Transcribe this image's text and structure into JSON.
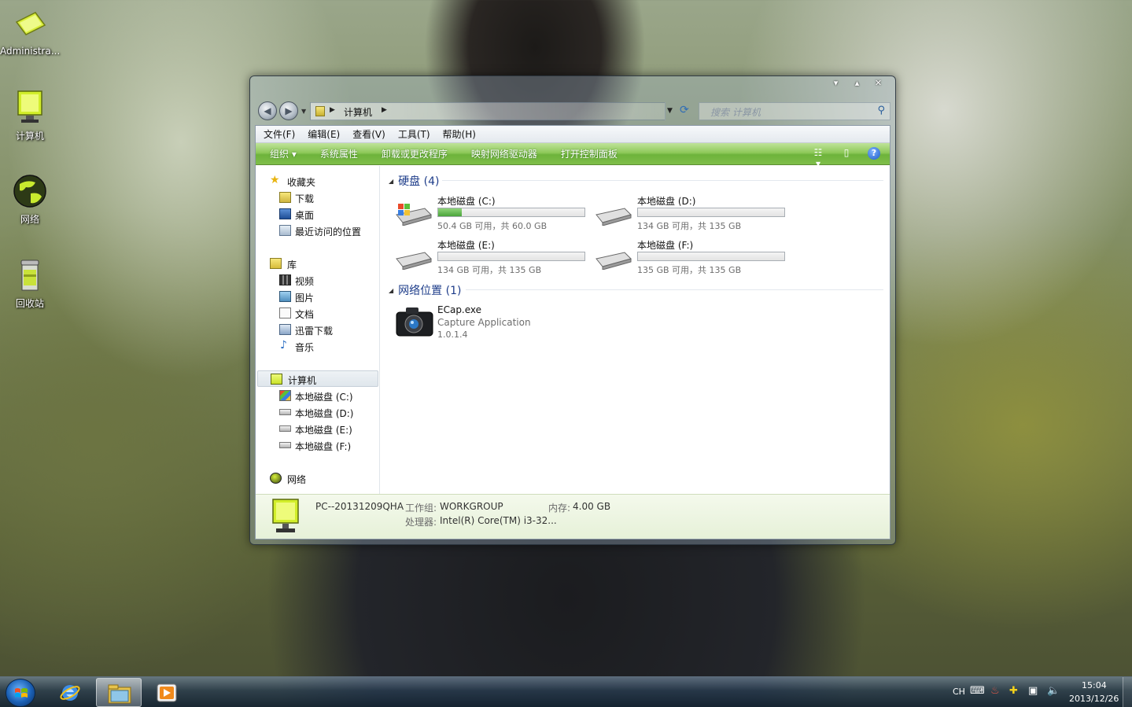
{
  "desktop": {
    "icons": [
      {
        "label": "Administra..."
      },
      {
        "label": "计算机"
      },
      {
        "label": "网络"
      },
      {
        "label": "回收站"
      }
    ]
  },
  "window": {
    "caption": {
      "minimize": "▾",
      "maximize": "▴",
      "close": "✕"
    },
    "address": {
      "crumb": "计算机"
    },
    "search": {
      "placeholder": "搜索 计算机"
    },
    "menu": [
      "文件(F)",
      "编辑(E)",
      "查看(V)",
      "工具(T)",
      "帮助(H)"
    ],
    "toolbar": {
      "organize": "组织 ▾",
      "items": [
        "系统属性",
        "卸载或更改程序",
        "映射网络驱动器",
        "打开控制面板"
      ]
    },
    "nav": {
      "favorites": "收藏夹",
      "fav_items": [
        "下载",
        "桌面",
        "最近访问的位置"
      ],
      "libraries": "库",
      "lib_items": [
        "视频",
        "图片",
        "文档",
        "迅雷下载",
        "音乐"
      ],
      "computer": "计算机",
      "comp_items": [
        "本地磁盘 (C:)",
        "本地磁盘 (D:)",
        "本地磁盘 (E:)",
        "本地磁盘 (F:)"
      ],
      "network": "网络"
    },
    "groups": {
      "drives_header": "硬盘 (4)",
      "network_header": "网络位置 (1)"
    },
    "drives": [
      {
        "name": "本地磁盘 (C:)",
        "info": "50.4 GB 可用，共 60.0 GB",
        "used_fraction": 0.16
      },
      {
        "name": "本地磁盘 (D:)",
        "info": "134 GB 可用，共 135 GB",
        "used_fraction": 0.0
      },
      {
        "name": "本地磁盘 (E:)",
        "info": "134 GB 可用，共 135 GB",
        "used_fraction": 0.0
      },
      {
        "name": "本地磁盘 (F:)",
        "info": "135 GB 可用，共 135 GB",
        "used_fraction": 0.0
      }
    ],
    "network_item": {
      "name": "ECap.exe",
      "description": "Capture Application",
      "version": "1.0.1.4"
    },
    "details": {
      "pc_name": "PC--20131209QHA",
      "workgroup_label": "工作组:",
      "workgroup": "WORKGROUP",
      "memory_label": "内存:",
      "memory": "4.00 GB",
      "cpu_label": "处理器:",
      "cpu": "Intel(R) Core(TM) i3-32..."
    }
  },
  "taskbar": {
    "lang": "CH",
    "time": "15:04",
    "date": "2013/12/26"
  },
  "colors": {
    "toolbar_green": "#7fbe4a",
    "group_header_blue": "#1e3d8a",
    "drive_fill_green": "#4aa43a"
  }
}
